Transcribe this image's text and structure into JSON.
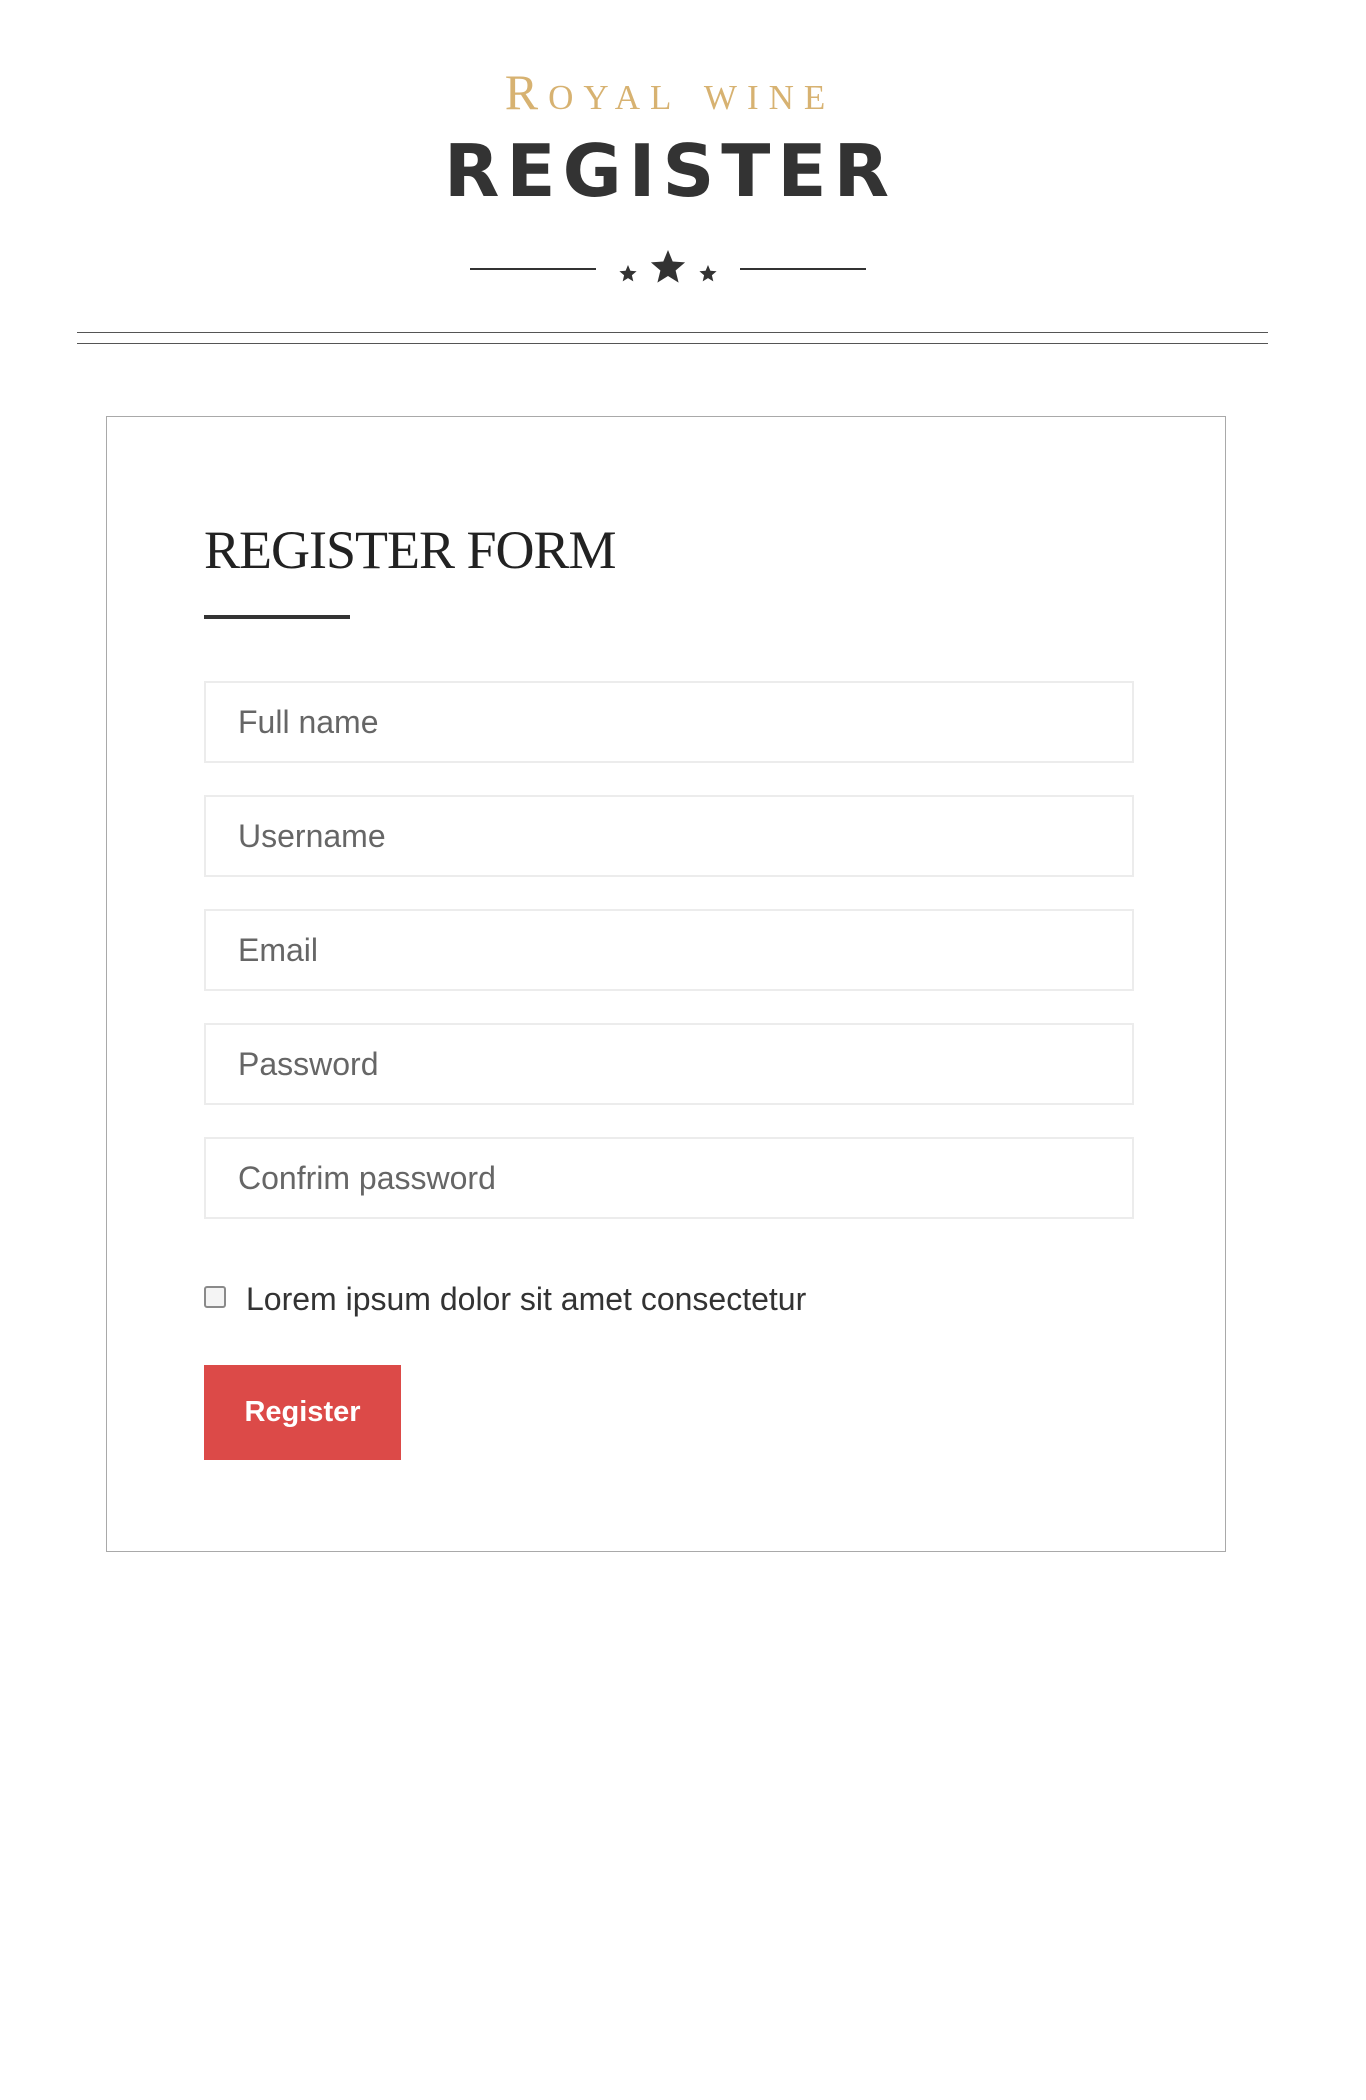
{
  "header": {
    "brand": "Royal wine",
    "title": "REGISTER",
    "ornament_icon": "stars-divider-icon"
  },
  "form": {
    "heading": "REGISTER FORM",
    "fields": {
      "full_name": {
        "value": "",
        "placeholder": "Full name"
      },
      "username": {
        "value": "",
        "placeholder": "Username"
      },
      "email": {
        "value": "",
        "placeholder": "Email"
      },
      "password": {
        "value": "",
        "placeholder": "Password"
      },
      "confirm_password": {
        "value": "",
        "placeholder": "Confrim password"
      }
    },
    "agree": {
      "label": "Lorem ipsum dolor sit amet consectetur",
      "checked": false
    },
    "submit_label": "Register"
  },
  "colors": {
    "brand": "#d7b271",
    "accent": "#dc4a48",
    "text": "#333333"
  }
}
